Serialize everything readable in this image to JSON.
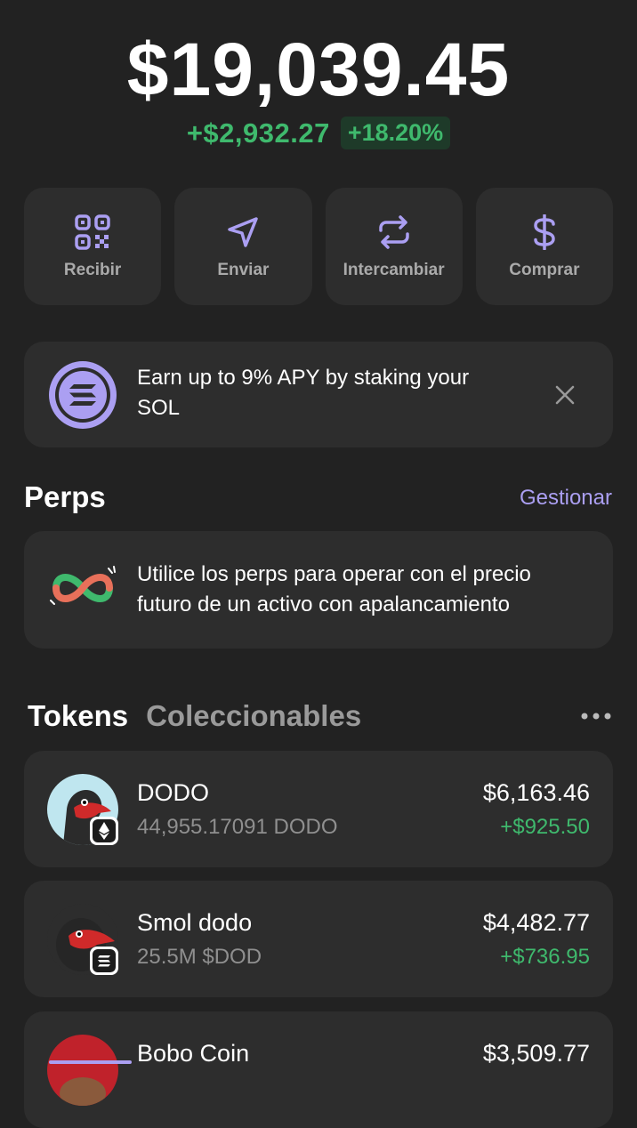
{
  "balance": "$19,039.45",
  "change": {
    "amount": "+$2,932.27",
    "percent": "+18.20%"
  },
  "actions": [
    {
      "label": "Recibir",
      "icon": "qr-code-icon"
    },
    {
      "label": "Enviar",
      "icon": "send-icon"
    },
    {
      "label": "Intercambiar",
      "icon": "swap-icon"
    },
    {
      "label": "Comprar",
      "icon": "dollar-icon"
    }
  ],
  "banner": {
    "text": "Earn up to 9% APY by staking your SOL",
    "icon": "solana-logo",
    "close_icon": "close-icon"
  },
  "perps": {
    "title": "Perps",
    "manage_label": "Gestionar",
    "text": "Utilice los perps para operar con el precio futuro de un activo con apalancamiento"
  },
  "tabs": [
    {
      "label": "Tokens",
      "active": true
    },
    {
      "label": "Coleccionables",
      "active": false
    }
  ],
  "tokens": [
    {
      "name": "DODO",
      "amount": "44,955.17091 DODO",
      "value": "$6,163.46",
      "change": "+$925.50",
      "chain": "ethereum"
    },
    {
      "name": "Smol dodo",
      "amount": "25.5M $DOD",
      "value": "$4,482.77",
      "change": "+$736.95",
      "chain": "solana"
    },
    {
      "name": "Bobo Coin",
      "value": "$3,509.77"
    }
  ],
  "colors": {
    "background": "#222222",
    "card": "#2d2d2d",
    "accent": "#ab9ff2",
    "positive": "#3fb96d"
  }
}
